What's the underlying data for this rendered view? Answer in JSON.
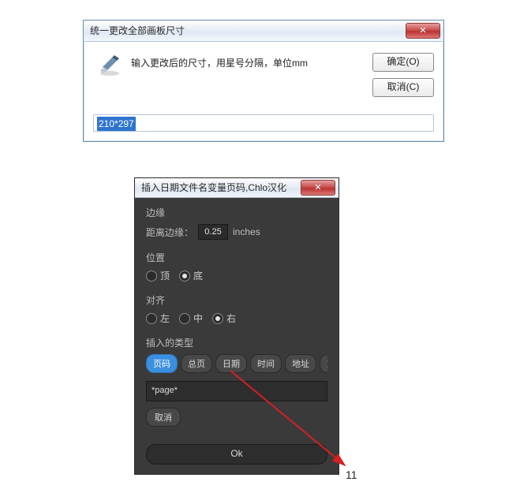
{
  "dialog1": {
    "title": "统一更改全部画板尺寸",
    "close_label": "✕",
    "prompt": "输入更改后的尺寸，用星号分隔，单位mm",
    "ok_label": "确定(O)",
    "cancel_label": "取消(C)",
    "input_value": "210*297"
  },
  "dialog2": {
    "title": "插入日期文件名变量页码,Chlo汉化",
    "close_label": "✕",
    "margin": {
      "section_label": "边缘",
      "label": "距离边缘：",
      "value": "0.25",
      "unit": "inches"
    },
    "position": {
      "section_label": "位置",
      "options": [
        "顶",
        "底"
      ],
      "selected": 1
    },
    "align": {
      "section_label": "对齐",
      "options": [
        "左",
        "中",
        "右"
      ],
      "selected": 2
    },
    "insert_type": {
      "section_label": "插入的类型",
      "options": [
        "页码",
        "总页",
        "日期",
        "时间",
        "地址",
        "文件名"
      ],
      "selected": 0
    },
    "token_value": "*page*",
    "cancel_label": "取消",
    "ok_label": "Ok"
  },
  "annotation": {
    "page_number": "11"
  }
}
